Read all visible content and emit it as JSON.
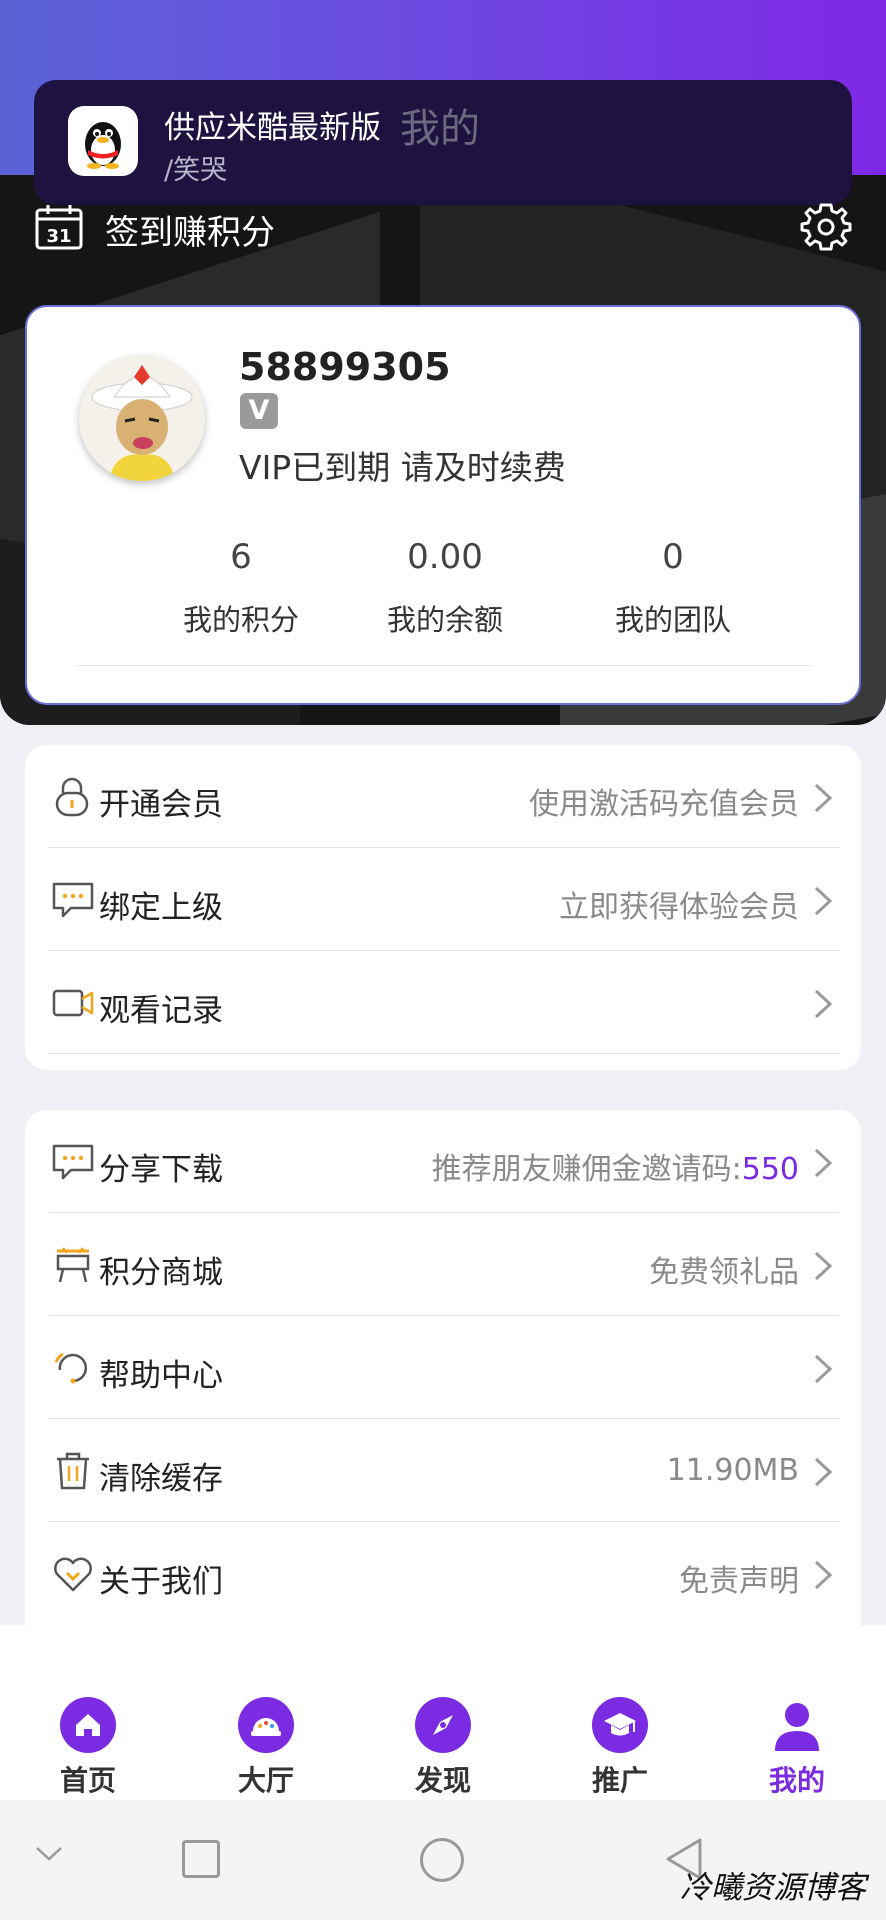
{
  "notification": {
    "app_name": "供应米酷最新版",
    "message": "/笑哭",
    "icon": "qq-penguin-icon"
  },
  "page_title": "我的",
  "checkin": {
    "label": "签到赚积分",
    "calendar_day": "31"
  },
  "profile": {
    "user_id": "58899305",
    "vip_badge": "V",
    "vip_status": "VIP已到期 请及时续费",
    "stats": [
      {
        "value": "6",
        "label": "我的积分"
      },
      {
        "value": "0.00",
        "label": "我的余额"
      },
      {
        "value": "0",
        "label": "我的团队"
      }
    ]
  },
  "menu1": [
    {
      "label": "开通会员",
      "right": "使用激活码充值会员",
      "icon": "lock-icon"
    },
    {
      "label": "绑定上级",
      "right": "立即获得体验会员",
      "icon": "message-icon"
    },
    {
      "label": "观看记录",
      "right": "",
      "icon": "video-icon"
    }
  ],
  "menu2": [
    {
      "label": "分享下载",
      "right": "推荐朋友赚佣金邀请码:",
      "code": "550",
      "icon": "message-icon"
    },
    {
      "label": "积分商城",
      "right": "免费领礼品",
      "icon": "shop-icon"
    },
    {
      "label": "帮助中心",
      "right": "",
      "icon": "help-icon"
    },
    {
      "label": "清除缓存",
      "right": "11.90MB",
      "icon": "trash-icon"
    },
    {
      "label": "关于我们",
      "right": "免责声明",
      "icon": "heart-icon"
    }
  ],
  "tabs": [
    {
      "label": "首页",
      "icon": "home-icon"
    },
    {
      "label": "大厅",
      "icon": "hall-icon"
    },
    {
      "label": "发现",
      "icon": "compass-icon"
    },
    {
      "label": "推广",
      "icon": "graduation-cap-icon"
    },
    {
      "label": "我的",
      "icon": "user-icon",
      "active": true
    }
  ],
  "watermark": "冷曦资源博客",
  "colors": {
    "accent": "#7b2be2",
    "gold": "#f3a61c"
  }
}
